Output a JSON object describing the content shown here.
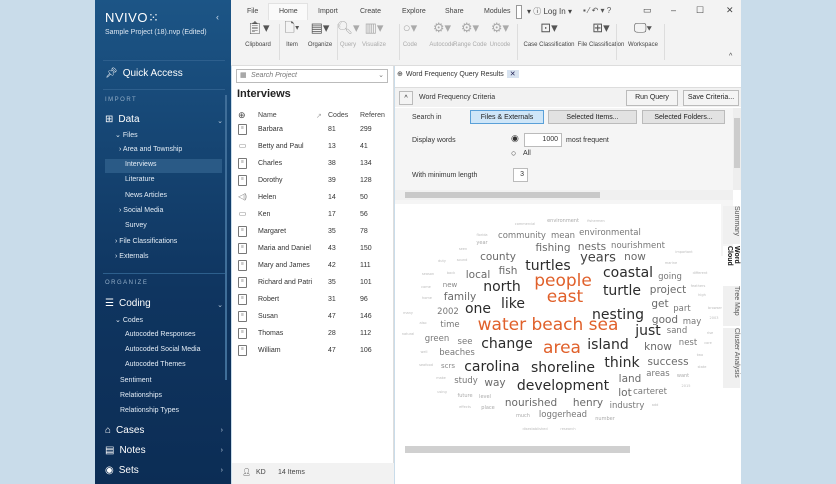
{
  "app": {
    "logo": "NVIVO",
    "logo_mark": "⁙",
    "project": "Sample Project (18).nvp (Edited)"
  },
  "sidebar": {
    "quick_access": "Quick Access",
    "import_label": "IMPORT",
    "data": "Data",
    "files": "Files",
    "file_items": [
      {
        "label": "Area and Township",
        "expand": true
      },
      {
        "label": "Interviews",
        "selected": true
      },
      {
        "label": "Literature"
      },
      {
        "label": "News Articles"
      },
      {
        "label": "Social Media",
        "expand": true
      },
      {
        "label": "Survey"
      }
    ],
    "file_classifications": "File Classifications",
    "externals": "Externals",
    "organize_label": "ORGANIZE",
    "coding": "Coding",
    "codes": "Codes",
    "code_items": [
      "Autocoded Responses",
      "Autocoded Social Media",
      "Autocoded Themes"
    ],
    "coding_items": [
      "Sentiment",
      "Relationships",
      "Relationship Types"
    ],
    "cases": "Cases",
    "notes": "Notes",
    "sets": "Sets"
  },
  "ribbon": {
    "tabs": [
      "File",
      "Home",
      "Import",
      "Create",
      "Explore",
      "Share",
      "Modules"
    ],
    "login": "Log In",
    "help": "?",
    "buttons": [
      {
        "label": "Clipboard",
        "icon": "clipboard"
      },
      {
        "label": "Item",
        "icon": "document"
      },
      {
        "label": "Organize",
        "icon": "organize"
      },
      {
        "label": "Query",
        "icon": "query",
        "disabled": true
      },
      {
        "label": "Visualize",
        "icon": "chart",
        "disabled": true
      },
      {
        "label": "Code",
        "icon": "circle",
        "disabled": true
      },
      {
        "label": "Autocode",
        "icon": "autocode",
        "disabled": true
      },
      {
        "label": "Range Code",
        "icon": "range",
        "disabled": true
      },
      {
        "label": "Uncode",
        "icon": "uncode",
        "disabled": true
      },
      {
        "label": "Case Classification",
        "icon": "case"
      },
      {
        "label": "File Classification",
        "icon": "file-class"
      },
      {
        "label": "Workspace",
        "icon": "workspace"
      }
    ]
  },
  "list": {
    "search_placeholder": "Search Project",
    "title": "Interviews",
    "columns": [
      "Name",
      "Codes",
      "Referen"
    ],
    "rows": [
      {
        "name": "Barbara",
        "codes": "81",
        "refs": "299",
        "type": "doc"
      },
      {
        "name": "Betty and Paul",
        "codes": "13",
        "refs": "41",
        "type": "video"
      },
      {
        "name": "Charles",
        "codes": "38",
        "refs": "134",
        "type": "doc"
      },
      {
        "name": "Dorothy",
        "codes": "39",
        "refs": "128",
        "type": "doc"
      },
      {
        "name": "Helen",
        "codes": "14",
        "refs": "50",
        "type": "audio"
      },
      {
        "name": "Ken",
        "codes": "17",
        "refs": "56",
        "type": "video"
      },
      {
        "name": "Margaret",
        "codes": "35",
        "refs": "78",
        "type": "doc"
      },
      {
        "name": "Maria and Daniel",
        "codes": "43",
        "refs": "150",
        "type": "doc"
      },
      {
        "name": "Mary and James",
        "codes": "42",
        "refs": "111",
        "type": "doc"
      },
      {
        "name": "Richard and Patri",
        "codes": "35",
        "refs": "101",
        "type": "doc"
      },
      {
        "name": "Robert",
        "codes": "31",
        "refs": "96",
        "type": "doc"
      },
      {
        "name": "Susan",
        "codes": "47",
        "refs": "146",
        "type": "doc"
      },
      {
        "name": "Thomas",
        "codes": "28",
        "refs": "112",
        "type": "doc"
      },
      {
        "name": "William",
        "codes": "47",
        "refs": "106",
        "type": "doc"
      }
    ]
  },
  "status": {
    "user": "KD",
    "count": "14 Items"
  },
  "query": {
    "tab_title": "Word Frequency Query Results",
    "criteria_title": "Word Frequency Criteria",
    "run": "Run Query",
    "save": "Save Criteria...",
    "search_in_label": "Search in",
    "search_options": [
      "Files & Externals",
      "Selected Items...",
      "Selected Folders..."
    ],
    "display_words_label": "Display words",
    "display_count": "1000",
    "most_frequent": "most frequent",
    "all": "All",
    "min_length_label": "With minimum length",
    "min_length": "3"
  },
  "view_tabs": [
    "Summary",
    "Word Cloud",
    "Tree Map",
    "Cluster Analysis"
  ],
  "colors": {
    "highlight": "#e0602a",
    "sidebar": "#0f3560"
  },
  "cloud_words": [
    {
      "t": "commercial",
      "w": 1
    },
    {
      "t": "environment",
      "w": 2
    },
    {
      "t": "fishermen",
      "w": 1
    },
    {
      "t": "florida",
      "w": 1
    },
    {
      "t": "community",
      "w": 4
    },
    {
      "t": "mean",
      "w": 4
    },
    {
      "t": "environmental",
      "w": 4
    },
    {
      "t": "year",
      "w": 2
    },
    {
      "t": "fishing",
      "w": 5
    },
    {
      "t": "nests",
      "w": 5
    },
    {
      "t": "nourishment",
      "w": 4
    },
    {
      "t": "important",
      "w": 1
    },
    {
      "t": "seen",
      "w": 1
    },
    {
      "t": "county",
      "w": 5
    },
    {
      "t": "years",
      "w": 6
    },
    {
      "t": "now",
      "w": 5
    },
    {
      "t": "duty",
      "w": 1
    },
    {
      "t": "sound",
      "w": 1
    },
    {
      "t": "turtles",
      "w": 7
    },
    {
      "t": "marine",
      "w": 1
    },
    {
      "t": "fish",
      "w": 5
    },
    {
      "t": "coastal",
      "w": 7
    },
    {
      "t": "local",
      "w": 5
    },
    {
      "t": "back",
      "w": 1
    },
    {
      "t": "season",
      "w": 1
    },
    {
      "t": "going",
      "w": 4
    },
    {
      "t": "different",
      "w": 1
    },
    {
      "t": "people",
      "w": 9,
      "hl": true
    },
    {
      "t": "north",
      "w": 7
    },
    {
      "t": "new",
      "w": 3
    },
    {
      "t": "come",
      "w": 1
    },
    {
      "t": "feathers",
      "w": 1
    },
    {
      "t": "turtle",
      "w": 7
    },
    {
      "t": "project",
      "w": 5
    },
    {
      "t": "family",
      "w": 5
    },
    {
      "t": "home",
      "w": 1
    },
    {
      "t": "high",
      "w": 1
    },
    {
      "t": "east",
      "w": 9,
      "hl": true
    },
    {
      "t": "like",
      "w": 7
    },
    {
      "t": "one",
      "w": 7
    },
    {
      "t": "get",
      "w": 5
    },
    {
      "t": "part",
      "w": 4
    },
    {
      "t": "2002",
      "w": 4
    },
    {
      "t": "nesting",
      "w": 7
    },
    {
      "t": "good",
      "w": 5
    },
    {
      "t": "may",
      "w": 4
    },
    {
      "t": "many",
      "w": 1
    },
    {
      "t": "2003",
      "w": 1
    },
    {
      "t": "browser",
      "w": 1
    },
    {
      "t": "water beach sea",
      "w": 9,
      "hl": true
    },
    {
      "t": "time",
      "w": 4
    },
    {
      "t": "also",
      "w": 1
    },
    {
      "t": "just",
      "w": 7
    },
    {
      "t": "sand",
      "w": 4
    },
    {
      "t": "natural",
      "w": 1
    },
    {
      "t": "rise",
      "w": 1
    },
    {
      "t": "green",
      "w": 4
    },
    {
      "t": "see",
      "w": 4
    },
    {
      "t": "change",
      "w": 7
    },
    {
      "t": "area",
      "w": 9,
      "hl": true
    },
    {
      "t": "island",
      "w": 7
    },
    {
      "t": "know",
      "w": 5
    },
    {
      "t": "nest",
      "w": 4
    },
    {
      "t": "core",
      "w": 1
    },
    {
      "t": "well",
      "w": 1
    },
    {
      "t": "beaches",
      "w": 4
    },
    {
      "t": "carolina",
      "w": 7
    },
    {
      "t": "shoreline",
      "w": 7
    },
    {
      "t": "think",
      "w": 7
    },
    {
      "t": "success",
      "w": 5
    },
    {
      "t": "scrs",
      "w": 3
    },
    {
      "t": "seafood",
      "w": 1
    },
    {
      "t": "two",
      "w": 1
    },
    {
      "t": "state",
      "w": 1
    },
    {
      "t": "study",
      "w": 4
    },
    {
      "t": "way",
      "w": 5
    },
    {
      "t": "land",
      "w": 5
    },
    {
      "t": "areas",
      "w": 4
    },
    {
      "t": "want",
      "w": 2
    },
    {
      "t": "make",
      "w": 1
    },
    {
      "t": "development",
      "w": 7
    },
    {
      "t": "2015",
      "w": 1
    },
    {
      "t": "using",
      "w": 1
    },
    {
      "t": "lot",
      "w": 5
    },
    {
      "t": "carteret",
      "w": 4
    },
    {
      "t": "future",
      "w": 2
    },
    {
      "t": "level",
      "w": 2
    },
    {
      "t": "nourished",
      "w": 5
    },
    {
      "t": "henry",
      "w": 5
    },
    {
      "t": "industry",
      "w": 4
    },
    {
      "t": "add",
      "w": 1
    },
    {
      "t": "effects",
      "w": 1
    },
    {
      "t": "place",
      "w": 2
    },
    {
      "t": "loggerhead",
      "w": 4
    },
    {
      "t": "much",
      "w": 2
    },
    {
      "t": "number",
      "w": 2
    },
    {
      "t": "disestablished",
      "w": 1
    },
    {
      "t": "research",
      "w": 1
    }
  ]
}
